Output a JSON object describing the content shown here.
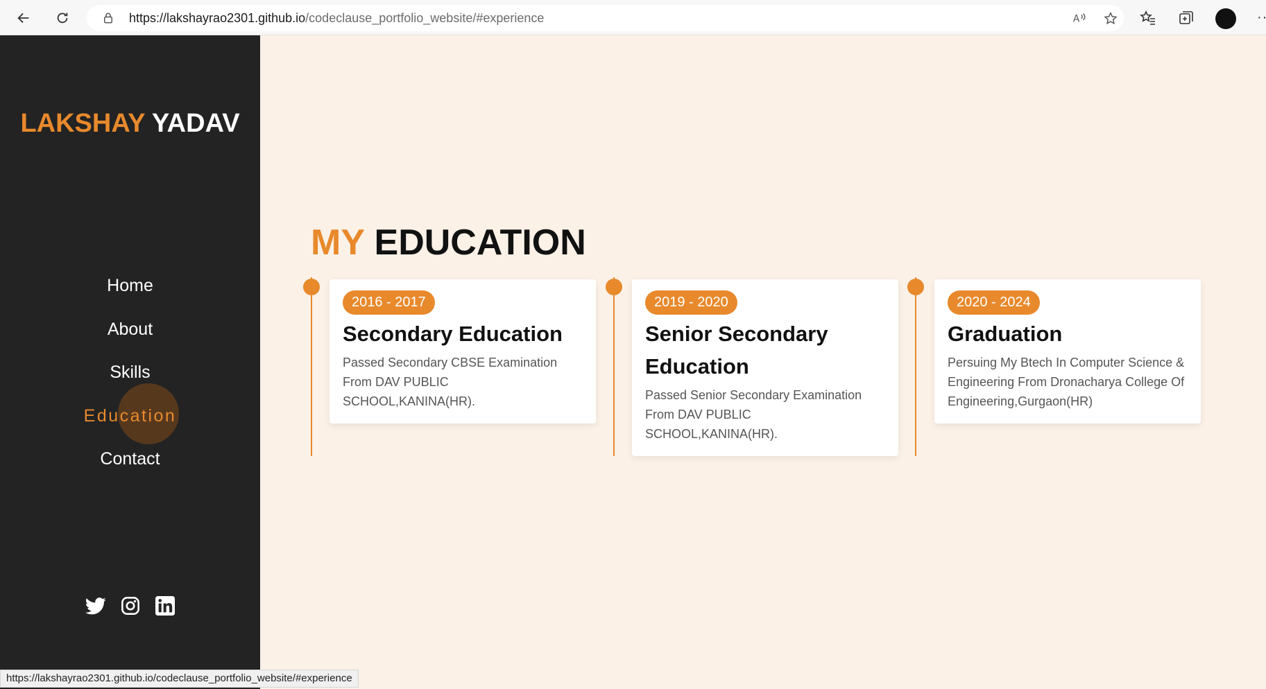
{
  "browser": {
    "url_host": "https://lakshayrao2301.github.io",
    "url_path": "/codeclause_portfolio_website/#experience"
  },
  "sidebar": {
    "logo_first": "LAKSHAY",
    "logo_last": "YADAV",
    "menu": [
      {
        "label": "Home",
        "active": false
      },
      {
        "label": "About",
        "active": false
      },
      {
        "label": "Skills",
        "active": false
      },
      {
        "label": "Education",
        "active": true
      },
      {
        "label": "Contact",
        "active": false
      }
    ],
    "socials": [
      "twitter-icon",
      "instagram-icon",
      "linkedin-icon"
    ]
  },
  "education": {
    "title_accent": "MY",
    "title_rest": "EDUCATION",
    "cards": [
      {
        "years": "2016 - 2017",
        "heading": "Secondary Education",
        "text": "Passed Secondary CBSE Examination From DAV PUBLIC SCHOOL,KANINA(HR)."
      },
      {
        "years": "2019 - 2020",
        "heading": "Senior Secondary Education",
        "text": "Passed Senior Secondary Examination From DAV PUBLIC SCHOOL,KANINA(HR)."
      },
      {
        "years": "2020 - 2024",
        "heading": "Graduation",
        "text": "Persuing My Btech In Computer Science & Engineering From Dronacharya College Of Engineering,Gurgaon(HR)"
      }
    ]
  },
  "status_bar": "https://lakshayrao2301.github.io/codeclause_portfolio_website/#experience",
  "colors": {
    "accent": "#e8892c",
    "sidebar": "#232323",
    "background": "#fbf1e7"
  }
}
